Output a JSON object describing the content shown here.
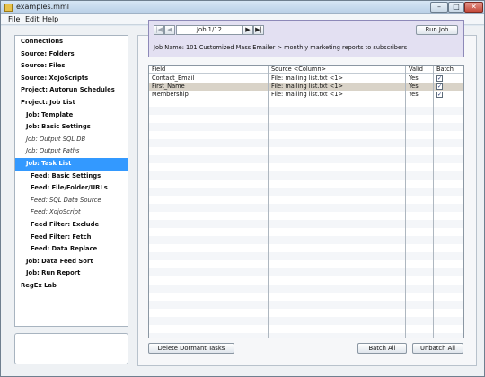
{
  "window": {
    "title": "examples.mml",
    "min_glyph": "–",
    "max_glyph": "□",
    "close_glyph": "✕"
  },
  "menu": [
    "File",
    "Edit",
    "Help"
  ],
  "sidebar": {
    "items": [
      {
        "label": "Connections"
      },
      {
        "label": "Source: Folders"
      },
      {
        "label": "Source: Files"
      },
      {
        "label": "Source: XojoScripts"
      },
      {
        "label": "Project: Autorun Schedules"
      },
      {
        "label": "Project: Job List"
      },
      {
        "label": "Job: Template"
      },
      {
        "label": "Job: Basic Settings"
      },
      {
        "label": "Job: Output SQL DB"
      },
      {
        "label": "Job: Output Paths"
      },
      {
        "label": "Job: Task List"
      },
      {
        "label": "Feed: Basic Settings"
      },
      {
        "label": "Feed: File/Folder/URLs"
      },
      {
        "label": "Feed: SQL Data Source"
      },
      {
        "label": "Feed: XojoScript"
      },
      {
        "label": "Feed Filter: Exclude"
      },
      {
        "label": "Feed Filter: Fetch"
      },
      {
        "label": "Feed: Data Replace"
      },
      {
        "label": "Job: Data Feed Sort"
      },
      {
        "label": "Job: Run Report"
      },
      {
        "label": "RegEx Lab"
      }
    ]
  },
  "job": {
    "counter": "Job 1/12",
    "run_label": "Run Job",
    "name": "Job Name: 101 Customized Mass Emailer > monthly marketing reports to subscribers",
    "first_glyph": "|◀",
    "prev_glyph": "◀",
    "next_glyph": "▶",
    "last_glyph": "▶|"
  },
  "table": {
    "headers": {
      "field": "Field",
      "source": "Source <Column>",
      "valid": "Valid",
      "batch": "Batch"
    },
    "rows": [
      {
        "field": "Contact_Email",
        "source": "File: mailing list.txt <1>",
        "valid": "Yes",
        "batch": "✓"
      },
      {
        "field": "First_Name",
        "source": "File: mailing list.txt <1>",
        "valid": "Yes",
        "batch": "✓"
      },
      {
        "field": "Membership",
        "source": "File: mailing list.txt <1>",
        "valid": "Yes",
        "batch": "✓"
      }
    ]
  },
  "buttons": {
    "delete_dormant": "Delete Dormant Tasks",
    "batch_all": "Batch All",
    "unbatch_all": "Unbatch All"
  },
  "colors": {
    "selected_sidebar": "#3399ff",
    "job_box": "#e3e0f2",
    "selected_row": "#d9d3c8"
  }
}
